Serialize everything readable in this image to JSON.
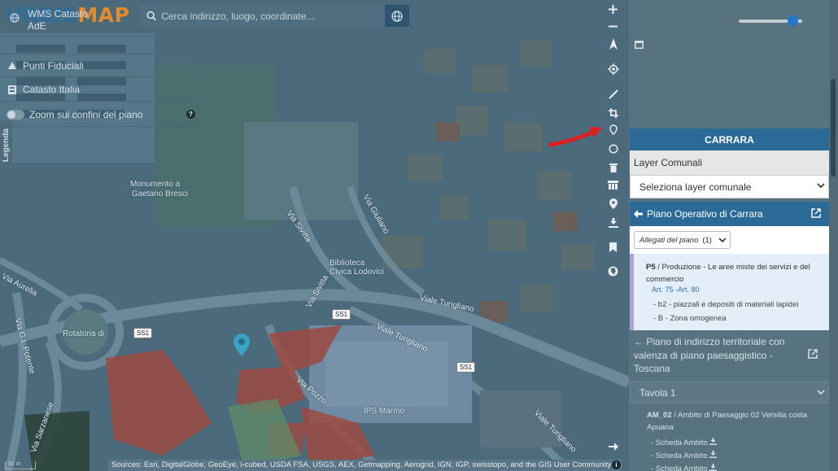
{
  "logo": {
    "part1": "URBIS",
    "part2": "MAP"
  },
  "search": {
    "placeholder": "Cerca indirizzo, luogo, coordinate..."
  },
  "legenda": {
    "label": "Legenda"
  },
  "map": {
    "labels": {
      "monument_line1": "Monumento a",
      "monument_line2": "Gaetano Bresci",
      "via_sivitta": "Via Sivitta",
      "via_sivitta2": "Via Sivitta",
      "via_giuliano": "Via Giuliano",
      "viale_turigliano": "Viale Turigliano",
      "viale_turigliano2": "Viale Turigliano",
      "viale_turigliano3": "Viale Turigliano",
      "via_aurelia": "Via Aurelia",
      "via_potente": "Via G.L.Potente",
      "via_sarzanese": "Via Sarzanese",
      "roundabout": "Rotatoria di",
      "biblioteca": "Biblioteca",
      "biblioteca2": "Civica Lodovici",
      "via_pozzo": "Via Pozzo",
      "ips_tag": "IPS Marmo"
    },
    "road_shields": [
      "SS1",
      "SS1",
      "SS1"
    ],
    "scale": "50 m",
    "attribution": "Sources: Esri, DigitalGlobe, GeoEye, i-cubed, USDA FSA, USGS, AEX, Getmapping, Aerogrid, IGN, IGP, swisstopo, and the GIS User Community"
  },
  "toolbar": {
    "icons": [
      "zoom-in-icon",
      "zoom-out-icon",
      "compass-icon",
      "locate-icon",
      "measure-line-icon",
      "crop-icon",
      "marker-outline-icon",
      "circle-icon",
      "trash-icon",
      "layers-icon",
      "pin-icon",
      "download-icon",
      "bookmark-icon",
      "globe-icon",
      "expand-icon"
    ]
  },
  "panel": {
    "wms_label": "WMS Catasto AdE",
    "wms_opacity": 0.85,
    "punti_fiduciali": "Punti Fiduciali",
    "catasto_italia": "Catasto Italia",
    "zoom_confini": "Zoom sui confini del piano",
    "carrara_header": "CARRARA",
    "layer_comunali": "Layer Comunali",
    "select_layer": "Seleziona layer comunale",
    "piano_operativo": "Piano Operativo di Carrara",
    "allegati_label": "Allegati del piano",
    "allegati_count": "(1)",
    "zone_code": "P5",
    "zone_desc": " / Produzione - Le aree miste dei servizi e del commercio",
    "articles": "Art. 75 -Art. 80",
    "line1": "- b2 - piazzali e depositi di materiali lapidei",
    "line2": "- B - Zona omogenea",
    "pit_title": "Piano di indirizzo territoriale con valenza di piano paesaggistico - Toscana",
    "tavola": "Tavola 1",
    "am_code": "AM_02",
    "am_desc": " / Ambito di Paesaggio 02 Versilia costa Apuana",
    "schede": [
      "- Scheda Ambito",
      "- Scheda Ambito",
      "- Scheda Ambito"
    ]
  },
  "colors": {
    "accent": "#2b6a97",
    "logo_blue": "#2c6e9b",
    "logo_orange": "#e38a2b",
    "arrow_red": "#e02020",
    "pin_teal": "#3aa3c4"
  }
}
